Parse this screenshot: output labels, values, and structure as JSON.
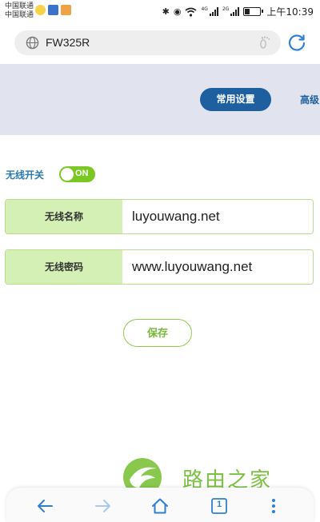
{
  "status_bar": {
    "carrier_1": "中国联通",
    "carrier_2": "中国联通",
    "net_tag_1": "4G",
    "net_tag_2": "2G",
    "time": "上午10:39",
    "icons": [
      "weibo-icon",
      "news-app-icon",
      "gift-app-icon",
      "bluetooth-icon",
      "eye-icon",
      "wifi-icon",
      "signal-icon",
      "battery-icon"
    ],
    "battery_level": 0.35
  },
  "browser": {
    "url": "FW325R",
    "icons": [
      "globe-icon",
      "footprint-icon",
      "reload-icon"
    ]
  },
  "router": {
    "tabs": {
      "common": "常用设置",
      "advanced": "高级"
    },
    "wifi_switch": {
      "label": "无线开关",
      "state_text": "ON",
      "on": true
    },
    "ssid": {
      "label": "无线名称",
      "value": "luyouwang.net"
    },
    "password": {
      "label": "无线密码",
      "value": "www.luyouwang.net"
    },
    "save_label": "保存"
  },
  "watermark": {
    "text": "路由之家"
  },
  "bottom_nav": {
    "tab_count": "1",
    "icons": [
      "back-arrow-icon",
      "forward-arrow-icon",
      "home-icon",
      "tabs-icon",
      "more-menu-icon"
    ]
  },
  "colors": {
    "accent_blue": "#1e5f9f",
    "label_blue": "#2a7ab0",
    "toggle_green": "#7cc823",
    "field_label_bg": "#d4f0b4",
    "save_green": "#78b93a",
    "header_band": "#e1e4ef",
    "nav_blue": "#2f7fd0"
  }
}
